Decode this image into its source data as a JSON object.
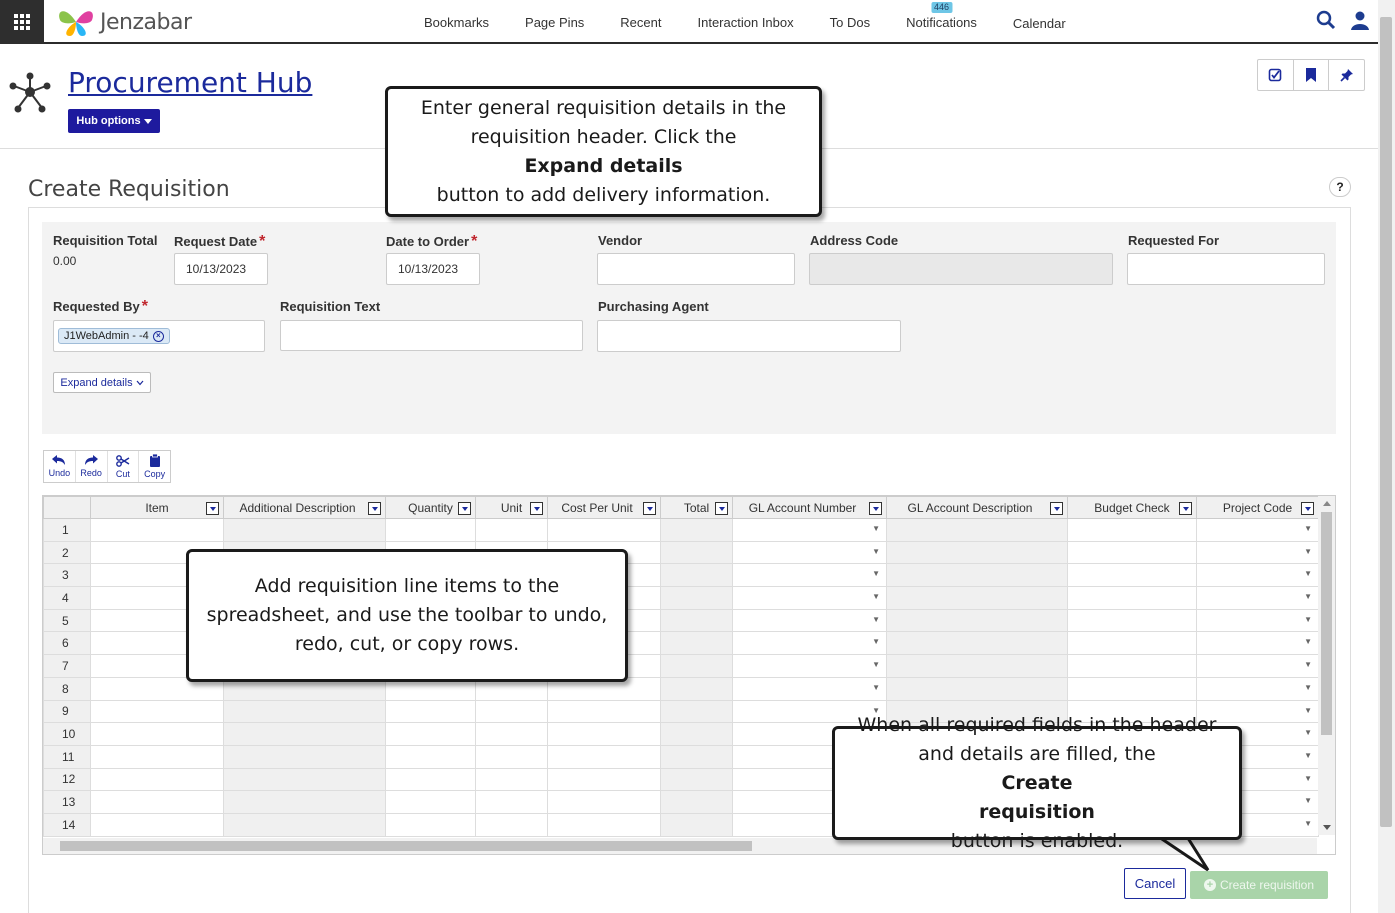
{
  "app": {
    "brand": "Jenzabar"
  },
  "nav": {
    "items": [
      "Bookmarks",
      "Page Pins",
      "Recent",
      "Interaction Inbox",
      "To Dos",
      "Notifications",
      "Calendar"
    ],
    "notification_count": "446"
  },
  "hub": {
    "title": "Procurement Hub",
    "options_label": "Hub options"
  },
  "section": {
    "title": "Create Requisition",
    "help": "?"
  },
  "form": {
    "requisition_total_label": "Requisition Total",
    "requisition_total_value": "0.00",
    "request_date_label": "Request Date",
    "request_date_value": "10/13/2023",
    "date_to_order_label": "Date to Order",
    "date_to_order_value": "10/13/2023",
    "vendor_label": "Vendor",
    "address_code_label": "Address Code",
    "requested_for_label": "Requested For",
    "requested_by_label": "Requested By",
    "requested_by_chip": "J1WebAdmin - -4",
    "requisition_text_label": "Requisition Text",
    "purchasing_agent_label": "Purchasing Agent",
    "required_mark": "*",
    "expand_details_label": "Expand details"
  },
  "toolbar": {
    "undo": "Undo",
    "redo": "Redo",
    "cut": "Cut",
    "copy": "Copy"
  },
  "sheet": {
    "columns": [
      "Item",
      "Additional Description",
      "Quantity",
      "Unit",
      "Cost Per Unit",
      "Total",
      "GL Account Number",
      "GL Account Description",
      "Budget Check",
      "Project Code"
    ],
    "row_numbers": [
      "1",
      "2",
      "3",
      "4",
      "5",
      "6",
      "7",
      "8",
      "9",
      "10",
      "11",
      "12",
      "13",
      "14"
    ]
  },
  "buttons": {
    "cancel": "Cancel",
    "create": "Create requisition"
  },
  "callouts": {
    "header": {
      "line1": "Enter general requisition details in the",
      "line2_a": "requisition header. Click the ",
      "line2_b": "Expand details",
      "line3": "button to add delivery information."
    },
    "sheet": {
      "line1": "Add requisition line items to the",
      "line2": "spreadsheet, and use the toolbar to undo,",
      "line3": "redo, cut, or copy rows."
    },
    "create": {
      "line1": "When all required fields in the header",
      "line2_a": "and details are filled, the ",
      "line2_b": "Create",
      "line3_a": "requisition",
      "line3_b": " button is enabled."
    }
  },
  "colors": {
    "brand_blue": "#1e1a9e",
    "link_blue": "#1b2a9c",
    "required_red": "#c0262d",
    "disabled_green": "#a9d4a9",
    "badge": "#6ec6e6"
  }
}
